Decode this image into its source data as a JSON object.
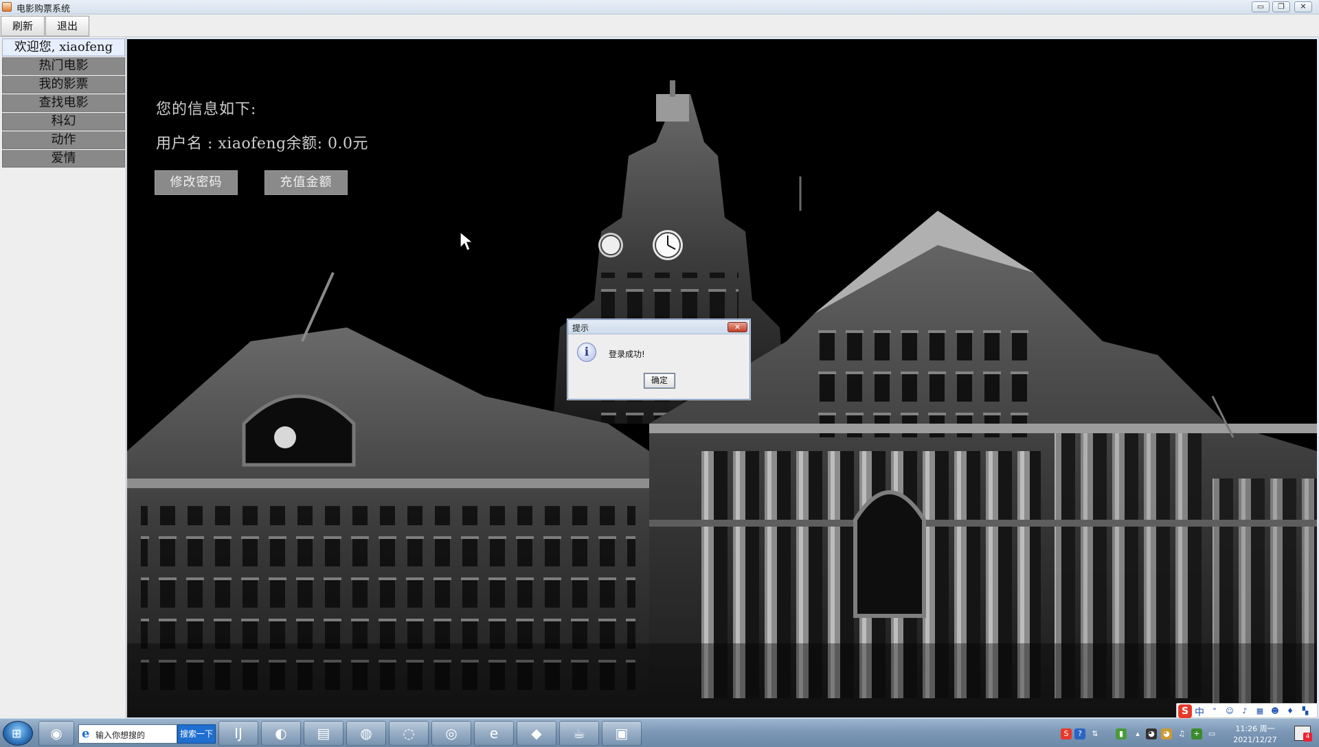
{
  "window": {
    "title": "电影购票系统",
    "controls": {
      "minimize": "▭",
      "maximize": "❐",
      "close": "✕"
    }
  },
  "toolbar": {
    "refresh_label": "刷新",
    "logout_label": "退出"
  },
  "sidebar": {
    "welcome": "欢迎您, xiaofeng",
    "items": [
      {
        "label": "热门电影"
      },
      {
        "label": "我的影票"
      },
      {
        "label": "查找电影"
      },
      {
        "label": "科幻"
      },
      {
        "label": "动作"
      },
      {
        "label": "爱情"
      }
    ]
  },
  "main": {
    "heading": "您的信息如下:",
    "info_line": "用户名 : xiaofeng余额: 0.0元",
    "change_password_label": "修改密码",
    "recharge_label": "充值金额",
    "background": "black-and-white photo of an ornate clock-tower building at night"
  },
  "dialog": {
    "title": "提示",
    "icon": "info-icon",
    "icon_glyph": "i",
    "message": "登录成功!",
    "ok_label": "确定",
    "close_glyph": "✕"
  },
  "taskbar": {
    "start_glyph": "⊞",
    "search_placeholder": "输入你想搜的",
    "search_button": "搜索一下",
    "ie_glyph": "e",
    "apps": [
      {
        "name": "ball-app-icon",
        "glyph": "◉"
      },
      {
        "name": "intellij-icon",
        "glyph": "IJ"
      },
      {
        "name": "firefox-icon",
        "glyph": "◐"
      },
      {
        "name": "file-explorer-icon",
        "glyph": "▤"
      },
      {
        "name": "app-icon",
        "glyph": "◍"
      },
      {
        "name": "wechat-icon",
        "glyph": "◌"
      },
      {
        "name": "chrome-icon",
        "glyph": "◎"
      },
      {
        "name": "360-browser-icon",
        "glyph": "e"
      },
      {
        "name": "folder-app-icon",
        "glyph": "◆"
      },
      {
        "name": "java-icon",
        "glyph": "☕"
      },
      {
        "name": "terminal-icon",
        "glyph": "▣"
      }
    ],
    "clock_time": "11:26 周一",
    "clock_date": "2021/12/27",
    "notify_count": "4",
    "ime": {
      "logo": "S",
      "lang": "中"
    }
  },
  "colors": {
    "main_bg": "#000000",
    "nav_button": "#898989",
    "welcome_bg": "#e7eefc",
    "taskbar": "#7c98b6",
    "search_button": "#1f6fd0"
  }
}
